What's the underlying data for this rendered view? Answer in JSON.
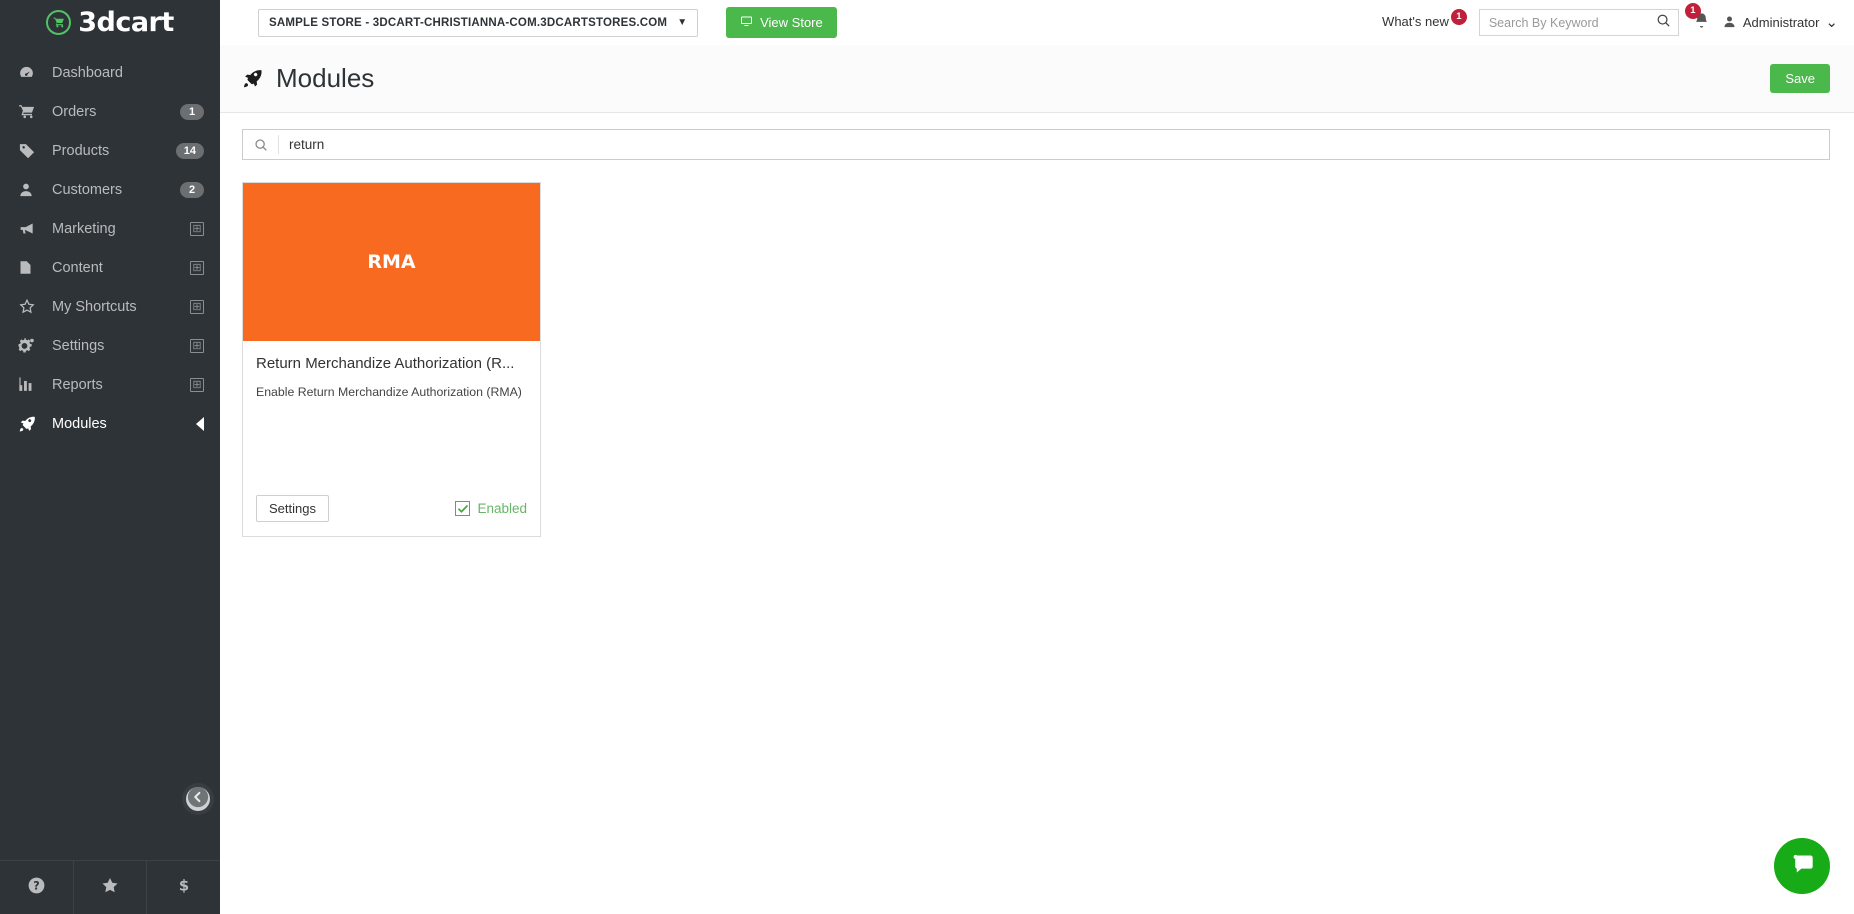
{
  "topbar": {
    "brand_name": "3dcart",
    "brand_icon": "shopping-cart-icon",
    "store_selector": {
      "label": "SAMPLE STORE - 3DCART-CHRISTIANNA-COM.3DCARTSTORES.COM",
      "caret": "▼"
    },
    "view_store_button": {
      "label": "View Store",
      "icon": "monitor-icon"
    },
    "whats_new": {
      "label": "What's new",
      "badge": "1"
    },
    "keyword_search": {
      "placeholder": "Search By Keyword",
      "value": "",
      "icon": "search-icon"
    },
    "notifications": {
      "icon": "bell-icon",
      "badge": "1"
    },
    "user_menu": {
      "icon": "user-icon",
      "label": "Administrator",
      "caret": "⌄"
    }
  },
  "sidebar": {
    "items": [
      {
        "label": "Dashboard",
        "icon": "dashboard-icon",
        "count": "",
        "expand": false,
        "active": false
      },
      {
        "label": "Orders",
        "icon": "cart-icon",
        "count": "1",
        "expand": false,
        "active": false
      },
      {
        "label": "Products",
        "icon": "tag-icon",
        "count": "14",
        "expand": false,
        "active": false
      },
      {
        "label": "Customers",
        "icon": "user-icon",
        "count": "2",
        "expand": false,
        "active": false
      },
      {
        "label": "Marketing",
        "icon": "megaphone-icon",
        "count": "",
        "expand": true,
        "active": false
      },
      {
        "label": "Content",
        "icon": "document-icon",
        "count": "",
        "expand": true,
        "active": false
      },
      {
        "label": "My Shortcuts",
        "icon": "star-icon",
        "count": "",
        "expand": true,
        "active": false
      },
      {
        "label": "Settings",
        "icon": "gear-icon",
        "count": "",
        "expand": true,
        "active": false
      },
      {
        "label": "Reports",
        "icon": "bar-chart-icon",
        "count": "",
        "expand": true,
        "active": false
      },
      {
        "label": "Modules",
        "icon": "rocket-icon",
        "count": "",
        "expand": false,
        "active": true
      }
    ],
    "collapse_button_icon": "arrow-left-circle-icon",
    "footer_icons": [
      {
        "name": "help-icon"
      },
      {
        "name": "star-icon"
      },
      {
        "name": "dollar-icon"
      }
    ]
  },
  "page": {
    "title": "Modules",
    "title_icon": "rocket-icon",
    "save_label": "Save",
    "module_search": {
      "value": "return",
      "placeholder": "",
      "icon": "search-icon"
    }
  },
  "modules": [
    {
      "banner_text": "RMA",
      "banner_color": "#f96a21",
      "title": "Return Merchandize Authorization (R...",
      "description": "Enable Return Merchandize Authorization (RMA)",
      "settings_label": "Settings",
      "enabled_label": "Enabled",
      "enabled": true
    }
  ],
  "chat": {
    "icon": "chat-bubble-icon",
    "color": "#17ab17"
  },
  "colors": {
    "sidebar_bg": "#2e3337",
    "green": "#4bb84b",
    "orange": "#f96a21",
    "red_badge": "#c0203a",
    "enabled_green": "#68b568"
  }
}
